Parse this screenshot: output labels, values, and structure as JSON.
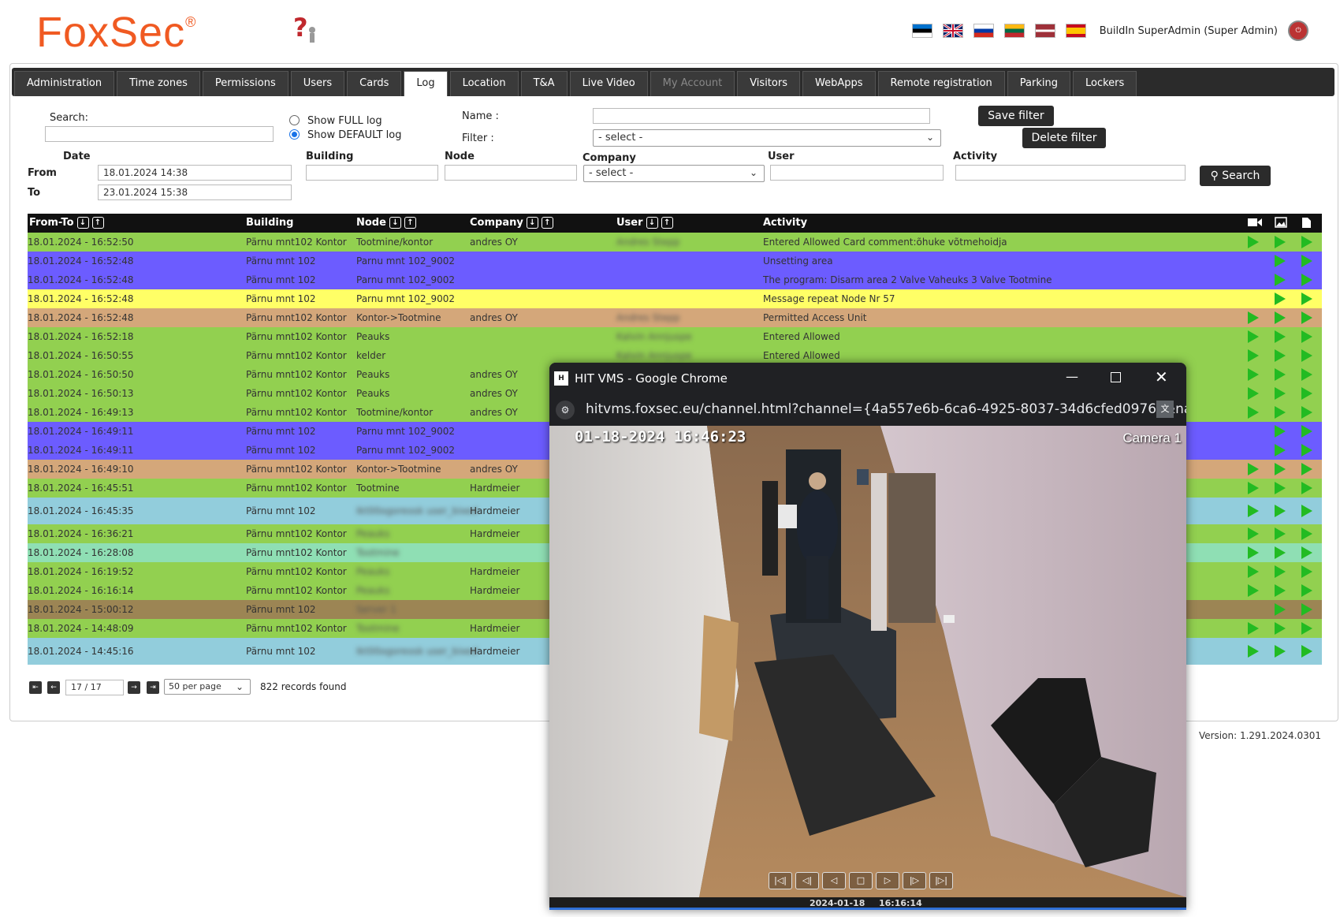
{
  "header": {
    "logo": "FoxSec",
    "logo_mark": "®",
    "user": "BuildIn SuperAdmin (Super Admin)",
    "flags": [
      "estonia-flag",
      "uk-flag",
      "russia-flag",
      "lithuania-flag",
      "latvia-flag",
      "spain-flag"
    ]
  },
  "tabs": [
    "Administration",
    "Time zones",
    "Permissions",
    "Users",
    "Cards",
    "Log",
    "Location",
    "T&A",
    "Live Video",
    "My Account",
    "Visitors",
    "WebApps",
    "Remote registration",
    "Parking",
    "Lockers"
  ],
  "active_tab": "Log",
  "filters": {
    "search_label": "Search:",
    "show_full": "Show FULL log",
    "show_default": "Show DEFAULT log",
    "name_label": "Name :",
    "filter_label": "Filter :",
    "filter_value": "- select -",
    "save_filter": "Save filter",
    "delete_filter": "Delete filter",
    "date_label": "Date",
    "from_label": "From",
    "from_value": "18.01.2024 14:38",
    "to_label": "To",
    "to_value": "23.01.2024 15:38",
    "building_label": "Building",
    "node_label": "Node",
    "company_label": "Company",
    "company_value": "- select -",
    "user_label": "User",
    "activity_label": "Activity",
    "search_button": "Search"
  },
  "table": {
    "headers": {
      "from_to": "From-To",
      "building": "Building",
      "node": "Node",
      "company": "Company",
      "user": "User",
      "activity": "Activity"
    },
    "rows": [
      {
        "bg": "#92d050",
        "date": "18.01.2024 - 16:52:50",
        "building": "Pärnu mnt102 Kontor",
        "node": "Tootmine/kontor",
        "company": "andres OY",
        "user": "Andres Stepp",
        "activity": "Entered Allowed Card comment:õhuke võtmehoidja",
        "v": true
      },
      {
        "bg": "#6c5cff",
        "date": "18.01.2024 - 16:52:48",
        "building": "Pärnu mnt 102",
        "node": "Parnu mnt 102_9002",
        "company": "",
        "user": "",
        "activity": "Unsetting area",
        "v": false
      },
      {
        "bg": "#6c5cff",
        "date": "18.01.2024 - 16:52:48",
        "building": "Pärnu mnt 102",
        "node": "Parnu mnt 102_9002",
        "company": "",
        "user": "",
        "activity": "The program: Disarm area 2 Valve Vaheuks 3 Valve Tootmine",
        "v": false
      },
      {
        "bg": "#ffff66",
        "date": "18.01.2024 - 16:52:48",
        "building": "Pärnu mnt 102",
        "node": "Parnu mnt 102_9002",
        "company": "",
        "user": "",
        "activity": "Message repeat Node Nr 57",
        "v": false
      },
      {
        "bg": "#d4a77a",
        "date": "18.01.2024 - 16:52:48",
        "building": "Pärnu mnt102 Kontor",
        "node": "Kontor->Tootmine",
        "company": "andres OY",
        "user": "Andres Stepp",
        "activity": "Permitted Access Unit",
        "v": true
      },
      {
        "bg": "#92d050",
        "date": "18.01.2024 - 16:52:18",
        "building": "Pärnu mnt102 Kontor",
        "node": "Peauks",
        "company": "",
        "user": "Kalvin Annjuspe",
        "activity": "Entered Allowed",
        "v": true
      },
      {
        "bg": "#92d050",
        "date": "18.01.2024 - 16:50:55",
        "building": "Pärnu mnt102 Kontor",
        "node": "kelder",
        "company": "",
        "user": "Kalvin Annjuspe",
        "activity": "Entered Allowed",
        "v": true
      },
      {
        "bg": "#92d050",
        "date": "18.01.2024 - 16:50:50",
        "building": "Pärnu mnt102 Kontor",
        "node": "Peauks",
        "company": "andres OY",
        "user": "",
        "activity": "",
        "v": true
      },
      {
        "bg": "#92d050",
        "date": "18.01.2024 - 16:50:13",
        "building": "Pärnu mnt102 Kontor",
        "node": "Peauks",
        "company": "andres OY",
        "user": "",
        "activity": "",
        "v": true
      },
      {
        "bg": "#92d050",
        "date": "18.01.2024 - 16:49:13",
        "building": "Pärnu mnt102 Kontor",
        "node": "Tootmine/kontor",
        "company": "andres OY",
        "user": "",
        "activity": "",
        "v": true
      },
      {
        "bg": "#6c5cff",
        "date": "18.01.2024 - 16:49:11",
        "building": "Pärnu mnt 102",
        "node": "Parnu mnt 102_9002",
        "company": "",
        "user": "",
        "activity": "",
        "v": false
      },
      {
        "bg": "#6c5cff",
        "date": "18.01.2024 - 16:49:11",
        "building": "Pärnu mnt 102",
        "node": "Parnu mnt 102_9002",
        "company": "",
        "user": "",
        "activity": "",
        "v": false
      },
      {
        "bg": "#d4a77a",
        "date": "18.01.2024 - 16:49:10",
        "building": "Pärnu mnt102 Kontor",
        "node": "Kontor->Tootmine",
        "company": "andres OY",
        "user": "",
        "activity": "",
        "v": true
      },
      {
        "bg": "#92d050",
        "date": "18.01.2024 - 16:45:51",
        "building": "Pärnu mnt102 Kontor",
        "node": "Tootmine",
        "company": "Hardmeier",
        "user": "",
        "activity": "",
        "v": true
      },
      {
        "bg": "#92cddc",
        "date": "18.01.2024 - 16:45:35",
        "building": "Pärnu mnt 102",
        "node": "Ikt00ogoreosk user_bixed",
        "company": "Hardmeier",
        "user": "",
        "activity": "",
        "v": true,
        "tall": true,
        "blur_node": true
      },
      {
        "bg": "#92d050",
        "date": "18.01.2024 - 16:36:21",
        "building": "Pärnu mnt102 Kontor",
        "node": "Peauks",
        "company": "Hardmeier",
        "user": "",
        "activity": "",
        "v": true,
        "blur_node": true
      },
      {
        "bg": "#8fdfb4",
        "date": "18.01.2024 - 16:28:08",
        "building": "Pärnu mnt102 Kontor",
        "node": "Tootmine",
        "company": "",
        "user": "",
        "activity": "",
        "v": true,
        "blur_node": true
      },
      {
        "bg": "#92d050",
        "date": "18.01.2024 - 16:19:52",
        "building": "Pärnu mnt102 Kontor",
        "node": "Peauks",
        "company": "Hardmeier",
        "user": "",
        "activity": "",
        "v": true,
        "blur_node": true
      },
      {
        "bg": "#92d050",
        "date": "18.01.2024 - 16:16:14",
        "building": "Pärnu mnt102 Kontor",
        "node": "Peauks",
        "company": "Hardmeier",
        "user": "",
        "activity": "",
        "v": true,
        "blur_node": true
      },
      {
        "bg": "#9c8554",
        "date": "18.01.2024 - 15:00:12",
        "building": "Pärnu mnt 102",
        "node": "Server 1",
        "company": "",
        "user": "",
        "activity": "",
        "v": false,
        "blur_node": true
      },
      {
        "bg": "#92d050",
        "date": "18.01.2024 - 14:48:09",
        "building": "Pärnu mnt102 Kontor",
        "node": "Tootmine",
        "company": "Hardmeier",
        "user": "",
        "activity": "",
        "v": true,
        "blur_node": true
      },
      {
        "bg": "#92cddc",
        "date": "18.01.2024 - 14:45:16",
        "building": "Pärnu mnt 102",
        "node": "Ikt00ogoreosk user_bixed",
        "company": "Hardmeier",
        "user": "",
        "activity": "",
        "v": true,
        "tall": true,
        "blur_node": true
      }
    ]
  },
  "pager": {
    "page": "17 / 17",
    "per_page": "50 per page",
    "records": "822 records found"
  },
  "version": "Version: 1.291.2024.0301",
  "popup": {
    "title": "HIT VMS - Google Chrome",
    "url": "hitvms.foxsec.eu/channel.html?channel={4a557e6b-6ca6-4925-8037-34d6cfed0976}&nam...",
    "osd_time": "01-18-2024 16:46:23",
    "camera": "Camera 1",
    "timeline_date": "2024-01-18",
    "timeline_time": "16:16:14"
  }
}
